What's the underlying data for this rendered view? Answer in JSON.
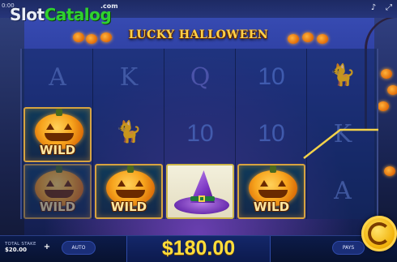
{
  "header": {
    "time": "0:00",
    "logo_slot": "Slot",
    "logo_catalog": "Catalog",
    "logo_com": ".com",
    "game_title": "LUCKY HALLOWEEN",
    "icons": [
      "sound-icon",
      "fullscreen-icon"
    ]
  },
  "reels": {
    "col1": [
      "A",
      "WILD",
      "WILD"
    ],
    "col2": [
      "K",
      "cat",
      "WILD"
    ],
    "col3": [
      "Q",
      "10",
      "witch-hat"
    ],
    "col4": [
      "10",
      "10",
      "WILD"
    ],
    "col5": [
      "cat",
      "K",
      "A"
    ]
  },
  "symbols": {
    "a": "A",
    "k": "K",
    "q": "Q",
    "ten": "10",
    "wild": "WILD"
  },
  "footer": {
    "total_stake_label": "TOTAL STAKE",
    "total_stake_value": "$20.00",
    "plus_label": "+",
    "auto_label": "AUTO",
    "win_amount": "$180.00",
    "pays_label": "PAYS"
  },
  "colors": {
    "win_text": "#ffdd3a",
    "wild_border": "#d6a340",
    "payline": "#f3d24a",
    "accent": "#1a2e78"
  }
}
